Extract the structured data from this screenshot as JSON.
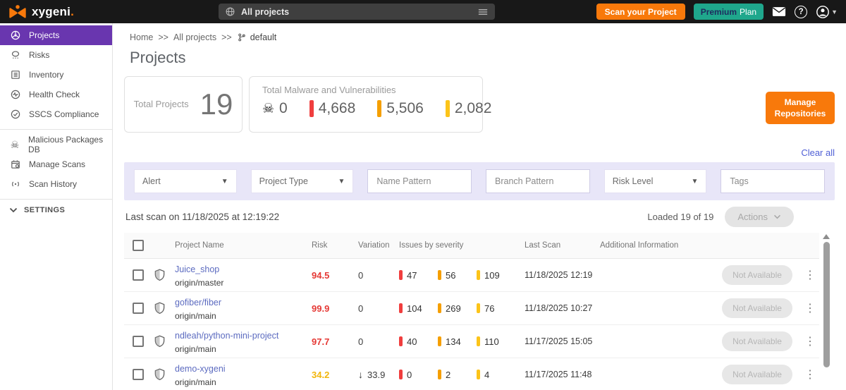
{
  "topbar": {
    "logo_text": "xygeni",
    "logo_dot": ".",
    "scope_label": "All projects",
    "scan_button_label": "Scan your Project",
    "premium_bold": "Premium",
    "premium_regular": "Plan",
    "help_glyph": "?"
  },
  "sidebar": {
    "items": [
      {
        "label": "Projects",
        "icon": "aperture-icon",
        "active": true
      },
      {
        "label": "Risks",
        "icon": "risks-icon",
        "active": false
      },
      {
        "label": "Inventory",
        "icon": "list-box-icon",
        "active": false
      },
      {
        "label": "Health Check",
        "icon": "pulse-icon",
        "active": false
      },
      {
        "label": "SSCS Compliance",
        "icon": "check-circle-icon",
        "active": false
      },
      {
        "label": "Malicious Packages DB",
        "icon": "skull-icon",
        "active": false
      },
      {
        "label": "Manage Scans",
        "icon": "calendar-icon",
        "active": false
      },
      {
        "label": "Scan History",
        "icon": "signal-icon",
        "active": false
      }
    ],
    "settings_label": "SETTINGS"
  },
  "breadcrumb": {
    "home": "Home",
    "sep1": ">>",
    "all_projects": "All projects",
    "sep2": ">>",
    "branch": "default"
  },
  "page_title": "Projects",
  "summary": {
    "total_label": "Total Projects",
    "total_value": "19",
    "malware_title": "Total Malware and Vulnerabilities",
    "malware_skull_glyph": "☠",
    "malware_count": "0",
    "critical_count": "4,668",
    "high_count": "5,506",
    "medium_count": "2,082"
  },
  "manage_repositories_label": "Manage Repositories",
  "clear_all_label": "Clear all",
  "filters": {
    "alert": "Alert",
    "project_type": "Project Type",
    "name_pattern": "Name Pattern",
    "branch_pattern": "Branch Pattern",
    "risk_level": "Risk Level",
    "tags": "Tags"
  },
  "toolbar": {
    "last_scan_text": "Last scan on 11/18/2025 at 12:19:22",
    "loaded_text": "Loaded 19 of 19",
    "actions_label": "Actions"
  },
  "table": {
    "headers": [
      "Project Name",
      "Risk",
      "Variation",
      "Issues by severity",
      "Last Scan",
      "Additional Information"
    ],
    "rows": [
      {
        "name": "Juice_shop",
        "branch": "origin/master",
        "risk": "94.5",
        "variation": "0",
        "variation_arrow": "",
        "critical": "47",
        "high": "56",
        "medium": "109",
        "last_scan": "11/18/2025 12:19",
        "action": "Not Available"
      },
      {
        "name": "gofiber/fiber",
        "branch": "origin/main",
        "risk": "99.9",
        "variation": "0",
        "variation_arrow": "",
        "critical": "104",
        "high": "269",
        "medium": "76",
        "last_scan": "11/18/2025 10:27",
        "action": "Not Available"
      },
      {
        "name": "ndleah/python-mini-project",
        "branch": "origin/main",
        "risk": "97.7",
        "variation": "0",
        "variation_arrow": "",
        "critical": "40",
        "high": "134",
        "medium": "110",
        "last_scan": "11/17/2025 15:05",
        "action": "Not Available"
      },
      {
        "name": "demo-xygeni",
        "branch": "origin/main",
        "risk": "34.2",
        "variation": "33.9",
        "variation_arrow": "↓",
        "critical": "0",
        "high": "2",
        "medium": "4",
        "last_scan": "11/17/2025 11:48",
        "action": "Not Available"
      }
    ]
  },
  "colors": {
    "brand_orange": "#f8790b",
    "brand_purple": "#6936af",
    "premium_teal": "#1fa78c",
    "topbar_black": "#181818",
    "severity_critical": "#f03e3e",
    "severity_high": "#f59f00",
    "severity_medium": "#fcc419",
    "risk_high_text": "#e53935",
    "risk_medium_text": "#f2b60b",
    "link_indigo": "#5c6bc0",
    "filterbar_lavender": "#e8e6f8"
  }
}
